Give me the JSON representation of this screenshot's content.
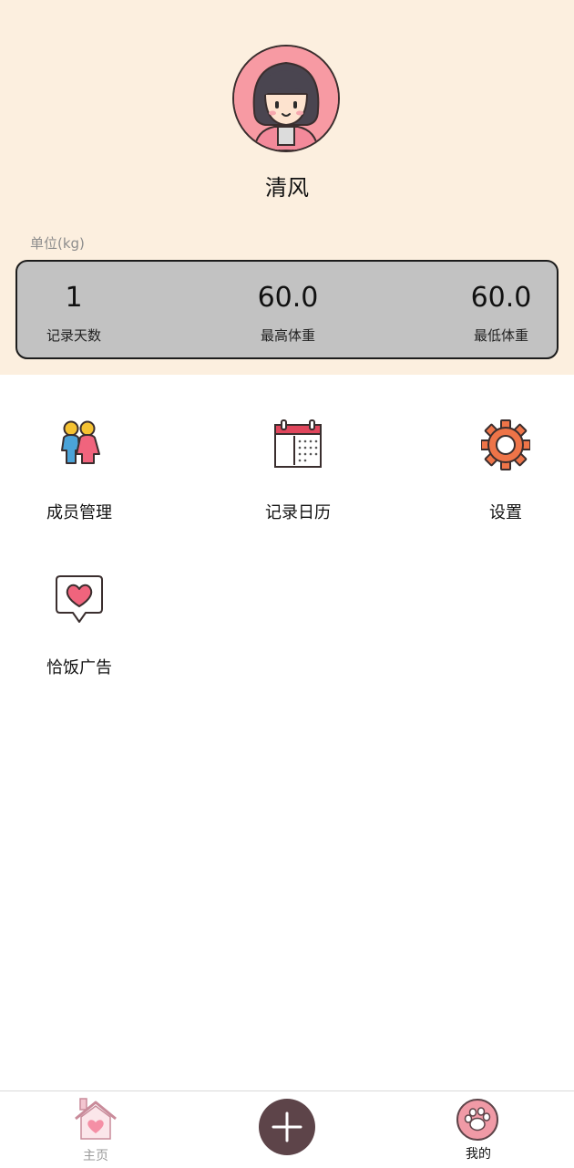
{
  "profile": {
    "username": "清风",
    "avatar_icon": "girl-avatar-icon"
  },
  "stats": {
    "unit_label": "单位(kg)",
    "items": [
      {
        "value": "1",
        "label": "记录天数"
      },
      {
        "value": "60.0",
        "label": "最高体重"
      },
      {
        "value": "60.0",
        "label": "最低体重"
      }
    ]
  },
  "menu": {
    "items": [
      {
        "label": "成员管理",
        "icon": "members-icon"
      },
      {
        "label": "记录日历",
        "icon": "calendar-icon"
      },
      {
        "label": "设置",
        "icon": "gear-icon"
      },
      {
        "label": "恰饭广告",
        "icon": "heart-bubble-icon"
      }
    ]
  },
  "bottom_nav": {
    "home_label": "主页",
    "add_icon": "plus-icon",
    "mine_label": "我的"
  },
  "colors": {
    "header_bg": "#fcefdf",
    "card_bg": "#c2c2c2",
    "fab_bg": "#5d4449",
    "accent_pink": "#f0647d"
  }
}
